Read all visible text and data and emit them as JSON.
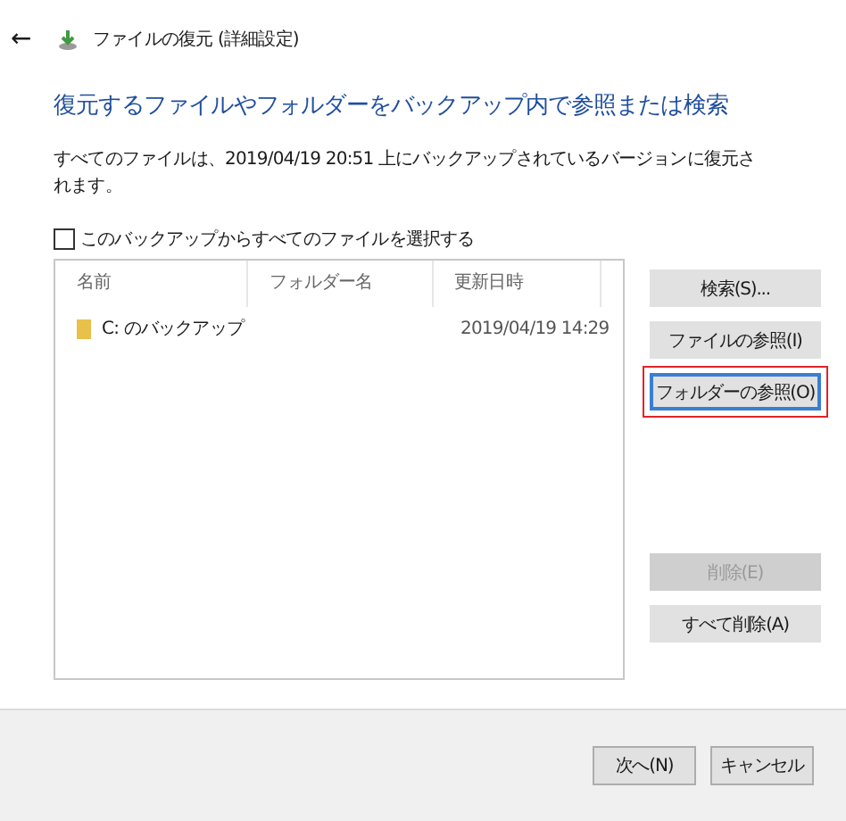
{
  "header": {
    "back": "←",
    "title": "ファイルの復元 (詳細設定)"
  },
  "heading": "復元するファイルやフォルダーをバックアップ内で参照または検索",
  "description": "すべてのファイルは、2019/04/19 20:51 上にバックアップされているバージョンに復元されます。",
  "select_all": {
    "label": "このバックアップからすべてのファイルを選択する",
    "checked": false
  },
  "table": {
    "columns": [
      "名前",
      "フォルダー名",
      "更新日時"
    ],
    "rows": [
      {
        "name": "C: のバックアップ",
        "folder": "",
        "modified": "2019/04/19 14:29"
      }
    ]
  },
  "side_buttons": [
    {
      "label": "検索(S)...",
      "disabled": false,
      "focused": false,
      "highlighted": false
    },
    {
      "label": "ファイルの参照(I)",
      "disabled": false,
      "focused": false,
      "highlighted": false
    },
    {
      "label": "フォルダーの参照(O)",
      "disabled": false,
      "focused": true,
      "highlighted": true
    },
    {
      "label": "削除(E)",
      "disabled": true,
      "focused": false,
      "highlighted": false
    },
    {
      "label": "すべて削除(A)",
      "disabled": false,
      "focused": false,
      "highlighted": false
    }
  ],
  "footer_buttons": [
    "次へ(N)",
    "キャンセル"
  ]
}
